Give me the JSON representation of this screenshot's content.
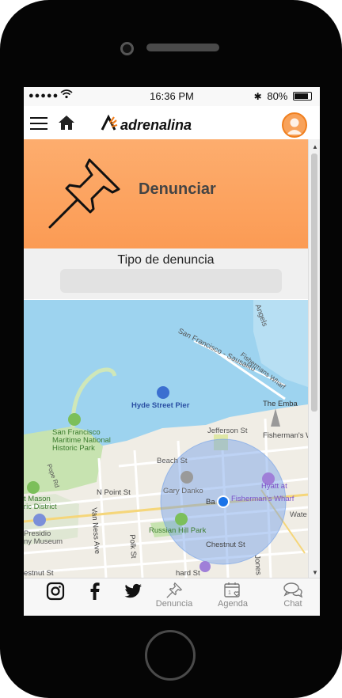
{
  "status_bar": {
    "signal": "●●●●●",
    "time": "16:36 PM",
    "battery": "80%"
  },
  "app": {
    "logo_text": "adrenalina"
  },
  "hero": {
    "title": "Denunciar"
  },
  "form": {
    "tipo_label": "Tipo de denuncia",
    "tipo_value": ""
  },
  "map": {
    "labels": {
      "road_ss": "San Francisco - Sausalito",
      "angels": "Angels",
      "fishermans_wharf_road": "Fishermans Wharf",
      "embarcadero": "The Emba",
      "hyde_pier": "Hyde Street Pier",
      "maritime": "San Francisco Maritime National Historic Park",
      "maritime_1": "San Francisco",
      "maritime_2": "Maritime National",
      "maritime_3": "Historic Park",
      "jefferson": "Jefferson St",
      "fw_area": "Fisherman's Wha",
      "beach": "Beach St",
      "gary_danko": "Gary Danko",
      "hyatt_1": "Hyatt at",
      "hyatt_2": "Fisherman's Wharf",
      "npoint": "N Point St",
      "van_ness": "Van Ness Ave",
      "pope_rd": "Pope Rd",
      "fort_mason": "t Mason",
      "fort_mason_2": "ric District",
      "presidio_1": "Presidio",
      "presidio_2": "ny Museum",
      "polk": "Polk St",
      "russian_hill": "Russian Hill Park",
      "chestnut": "Chestnut St",
      "chestnut_left": "estnut St",
      "bay": "Ba",
      "jones": "Jones",
      "wate": "Wate",
      "hyde_st": "hard St"
    },
    "colors": {
      "water": "#9dd3ef",
      "park": "#c7e3b0",
      "land": "#f0ede5",
      "radius": "#6f9ee8",
      "location": "#1a73e8"
    }
  },
  "tabs": [
    {
      "label": "",
      "icon": "instagram-icon"
    },
    {
      "label": "",
      "icon": "facebook-icon"
    },
    {
      "label": "",
      "icon": "twitter-icon"
    },
    {
      "label": "Denuncia",
      "icon": "pushpin-icon"
    },
    {
      "label": "Agenda",
      "icon": "calendar-heart-icon"
    },
    {
      "label": "Chat",
      "icon": "chat-icon"
    }
  ],
  "colors": {
    "accent": "#f07f1e",
    "hero_top": "#fdad6e",
    "hero_bottom": "#fb9b54"
  }
}
